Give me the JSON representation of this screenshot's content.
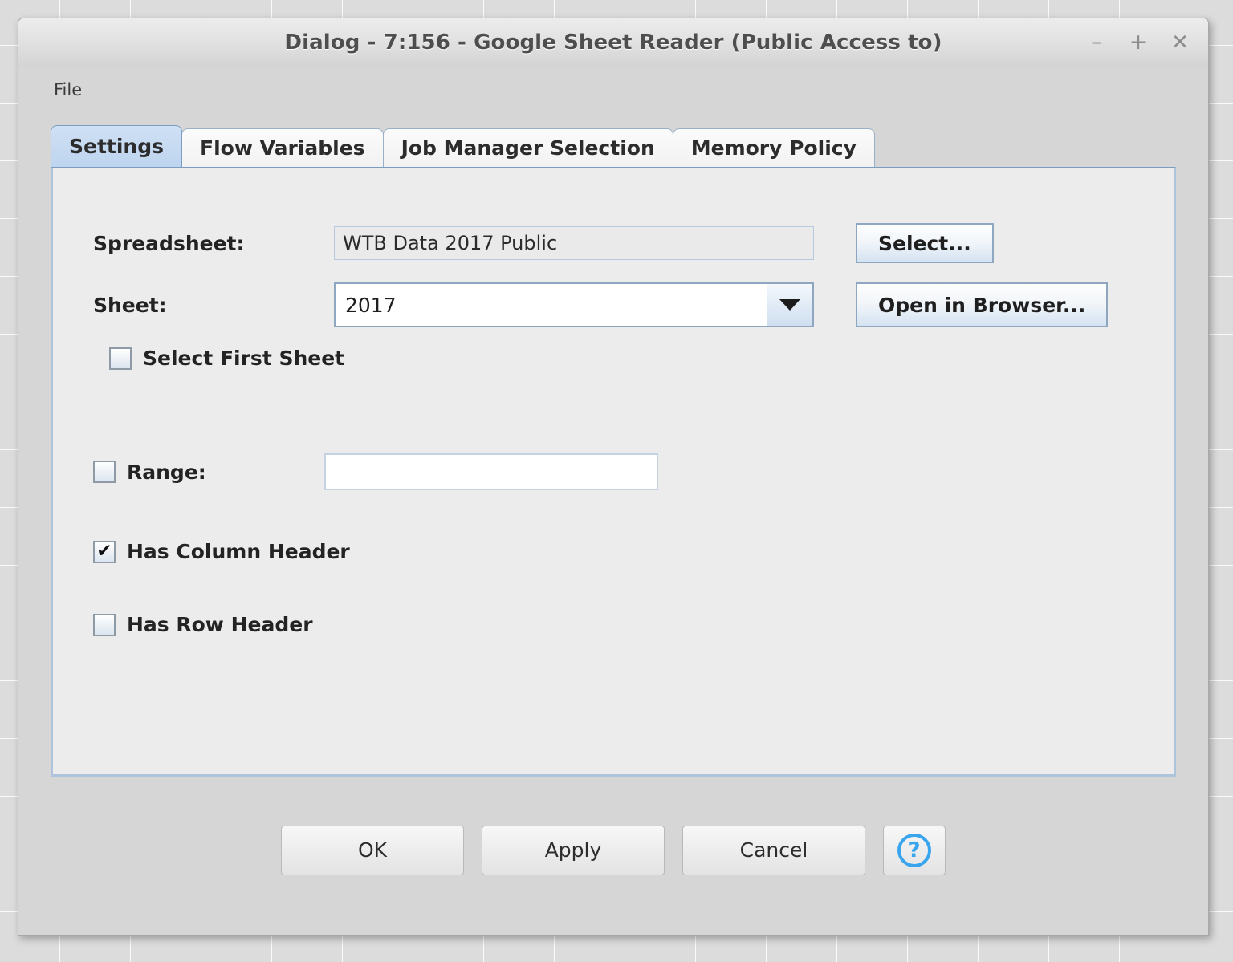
{
  "window": {
    "title": "Dialog - 7:156 - Google Sheet Reader (Public Access to)",
    "controls": {
      "minimize": "–",
      "maximize": "+",
      "close": "✕"
    }
  },
  "menubar": {
    "items": [
      {
        "label": "File"
      }
    ]
  },
  "tabs": [
    {
      "label": "Settings",
      "active": true
    },
    {
      "label": "Flow Variables",
      "active": false
    },
    {
      "label": "Job Manager Selection",
      "active": false
    },
    {
      "label": "Memory Policy",
      "active": false
    }
  ],
  "settings": {
    "spreadsheet": {
      "label": "Spreadsheet:",
      "value": "WTB Data 2017 Public",
      "placeholder": "",
      "button": "Select..."
    },
    "sheet": {
      "label": "Sheet:",
      "value": "2017",
      "options": [
        "2017"
      ],
      "button": "Open in Browser..."
    },
    "select_first_sheet": {
      "label": "Select First Sheet",
      "checked": false
    },
    "range": {
      "label": "Range:",
      "checked": false,
      "value": "",
      "placeholder": ""
    },
    "has_column_header": {
      "label": "Has Column Header",
      "checked": true
    },
    "has_row_header": {
      "label": "Has Row Header",
      "checked": false
    }
  },
  "footer": {
    "ok": "OK",
    "apply": "Apply",
    "cancel": "Cancel",
    "help": "?"
  },
  "colors": {
    "accent_blue": "#3aa5ef",
    "tab_active": "#c5d9f1",
    "dialog_bg": "#d6d6d6",
    "panel_bg": "#ececec"
  }
}
